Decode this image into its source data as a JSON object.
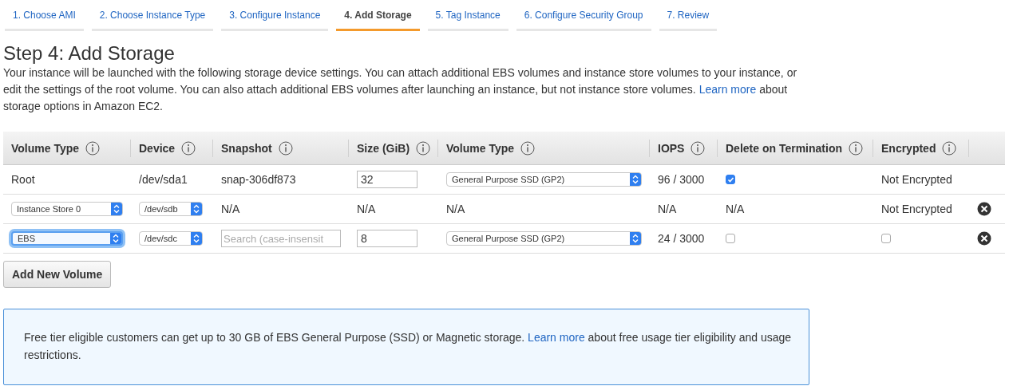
{
  "steps": [
    {
      "label": "1. Choose AMI",
      "selected": false
    },
    {
      "label": "2. Choose Instance Type",
      "selected": false
    },
    {
      "label": "3. Configure Instance",
      "selected": false
    },
    {
      "label": "4. Add Storage",
      "selected": true
    },
    {
      "label": "5. Tag Instance",
      "selected": false
    },
    {
      "label": "6. Configure Security Group",
      "selected": false
    },
    {
      "label": "7. Review",
      "selected": false
    }
  ],
  "heading": "Step 4: Add Storage",
  "intro": {
    "before": "Your instance will be launched with the following storage device settings. You can attach additional EBS volumes and instance store volumes to your instance, or edit the settings of the root volume. You can also attach additional EBS volumes after launching an instance, but not instance store volumes.",
    "link": "Learn more",
    "after": "about storage options in Amazon EC2."
  },
  "table": {
    "columns": [
      "Volume Type",
      "Device",
      "Snapshot",
      "Size (GiB)",
      "Volume Type",
      "IOPS",
      "Delete on Termination",
      "Encrypted"
    ],
    "rows": [
      {
        "removable": false,
        "cells": [
          {
            "kind": "text",
            "text": "Root"
          },
          {
            "kind": "text",
            "text": "/dev/sda1"
          },
          {
            "kind": "text",
            "text": "snap-306df873"
          },
          {
            "kind": "input",
            "value": "32"
          },
          {
            "kind": "select",
            "value": "General Purpose SSD (GP2)",
            "focused": false
          },
          {
            "kind": "text",
            "text": "96 / 3000"
          },
          {
            "kind": "checkbox",
            "checked": true
          },
          {
            "kind": "text",
            "text": "Not Encrypted"
          }
        ]
      },
      {
        "removable": true,
        "cells": [
          {
            "kind": "select",
            "value": "Instance Store 0",
            "focused": false
          },
          {
            "kind": "select",
            "value": "/dev/sdb",
            "focused": false
          },
          {
            "kind": "text",
            "text": "N/A"
          },
          {
            "kind": "text",
            "text": "N/A"
          },
          {
            "kind": "text",
            "text": "N/A"
          },
          {
            "kind": "text",
            "text": "N/A"
          },
          {
            "kind": "text",
            "text": "N/A"
          },
          {
            "kind": "text",
            "text": "Not Encrypted"
          }
        ]
      },
      {
        "removable": true,
        "cells": [
          {
            "kind": "select",
            "value": "EBS",
            "focused": true
          },
          {
            "kind": "select",
            "value": "/dev/sdc",
            "focused": false
          },
          {
            "kind": "input",
            "placeholder": "Search (case-insensit"
          },
          {
            "kind": "input",
            "value": "8"
          },
          {
            "kind": "select",
            "value": "General Purpose SSD (GP2)",
            "focused": false
          },
          {
            "kind": "text",
            "text": "24 / 3000"
          },
          {
            "kind": "checkbox",
            "checked": false
          },
          {
            "kind": "checkbox",
            "checked": false
          }
        ]
      }
    ]
  },
  "add_button": "Add New Volume",
  "notice": {
    "before": "Free tier eligible customers can get up to 30 GB of EBS General Purpose (SSD) or Magnetic storage.",
    "link": "Learn more",
    "after": "about free usage tier eligibility and usage restrictions."
  }
}
